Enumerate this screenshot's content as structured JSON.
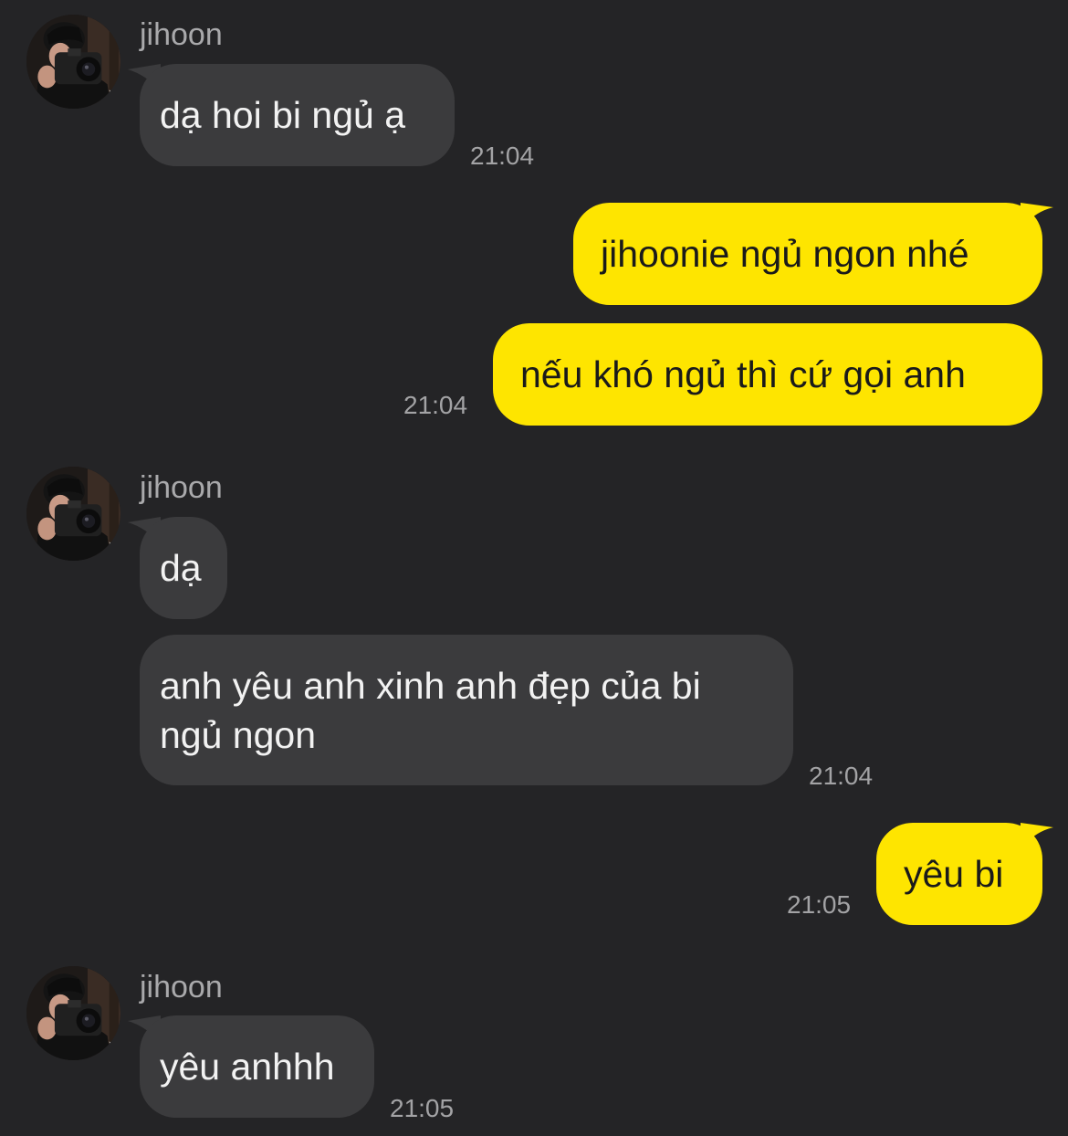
{
  "colors": {
    "background": "#242426",
    "incoming_bubble": "#3b3b3d",
    "outgoing_bubble": "#fee500"
  },
  "messages": [
    {
      "sender": "jihoon",
      "text": "dạ hoi bi ngủ ạ",
      "time": "21:04"
    },
    {
      "text": "jihoonie ngủ ngon nhé"
    },
    {
      "text": "nếu khó ngủ thì cứ gọi anh",
      "time": "21:04"
    },
    {
      "sender": "jihoon",
      "text": "dạ"
    },
    {
      "text": "anh yêu anh xinh anh đẹp của bi ngủ ngon",
      "time": "21:04"
    },
    {
      "text": "yêu bi",
      "time": "21:05"
    },
    {
      "sender": "jihoon",
      "text": "yêu anhhh",
      "time": "21:05"
    }
  ],
  "icons": {
    "avatar": "profile-photo-person-with-camera"
  }
}
